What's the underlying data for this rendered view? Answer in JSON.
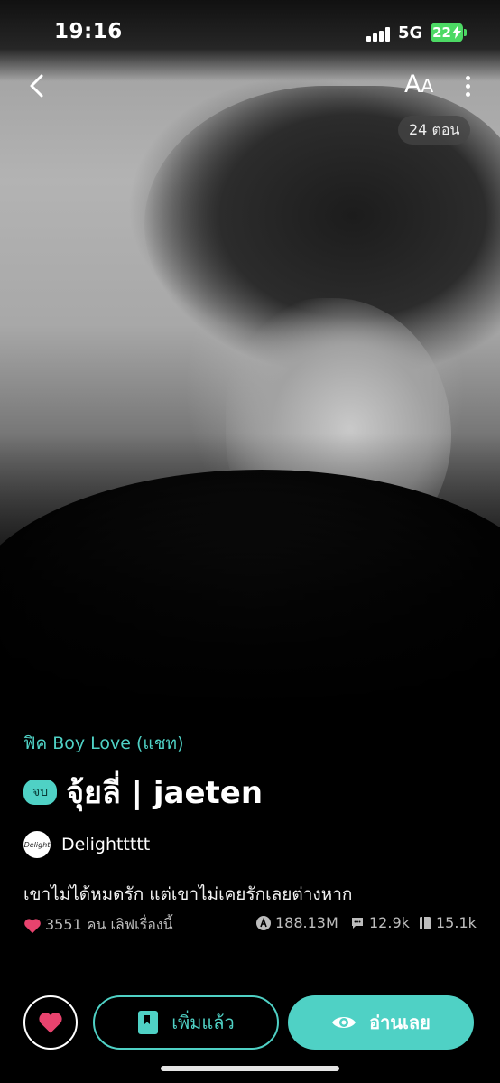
{
  "status_bar": {
    "time": "19:16",
    "network": "5G",
    "battery": "22"
  },
  "header": {
    "font_size_label": "A",
    "font_size_label_small": "A",
    "episode_count": "24 ตอน"
  },
  "story": {
    "genre": "ฟิค Boy Love (แชท)",
    "status_badge": "จบ",
    "title": "จุ้ยลี่ | jaeten",
    "author": "Delighttttt",
    "author_avatar_text": "Delight",
    "synopsis": "เขาไม่ได้หมดรัก แต่เขาไม่เคยรักเลยต่างหาก",
    "likes_text": "3551 คน เลิฟเรื่องนี้",
    "views": "188.13M",
    "comments": "12.9k",
    "bookmarks": "15.1k"
  },
  "actions": {
    "added_label": "เพิ่มแล้ว",
    "read_label": "อ่านเลย"
  },
  "colors": {
    "accent": "#4fd1c5",
    "heart": "#e8436e",
    "battery": "#4cd964"
  },
  "icons": {
    "back": "chevron-left-icon",
    "more": "vertical-dots-icon",
    "heart": "heart-icon",
    "views": "views-icon",
    "comments": "comment-icon",
    "bookmarks": "book-icon",
    "added": "bookmark-book-icon",
    "read": "eye-icon"
  }
}
